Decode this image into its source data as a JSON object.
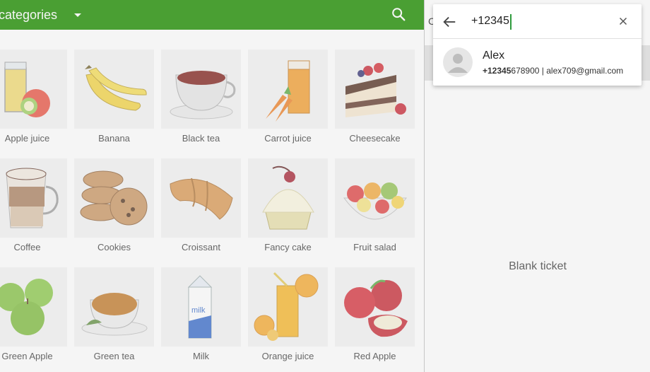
{
  "topbar": {
    "title": "categories"
  },
  "products": [
    {
      "name": "Apple juice"
    },
    {
      "name": "Banana"
    },
    {
      "name": "Black tea"
    },
    {
      "name": "Carrot juice"
    },
    {
      "name": "Cheesecake"
    },
    {
      "name": "Coffee"
    },
    {
      "name": "Cookies"
    },
    {
      "name": "Croissant"
    },
    {
      "name": "Fancy cake"
    },
    {
      "name": "Fruit salad"
    },
    {
      "name": "Green Apple"
    },
    {
      "name": "Green tea"
    },
    {
      "name": "Milk"
    },
    {
      "name": "Orange juice"
    },
    {
      "name": "Red Apple"
    }
  ],
  "ticket": {
    "header_chip": "C",
    "blank_text": "Blank ticket"
  },
  "customer_search": {
    "query": "+12345",
    "results": [
      {
        "name": "Alex",
        "phone_match": "+12345",
        "phone_rest": "678900",
        "separator": " | ",
        "email": "alex709@gmail.com"
      }
    ]
  },
  "colors": {
    "accent": "#4ea636",
    "caret": "#2e9b3c"
  }
}
